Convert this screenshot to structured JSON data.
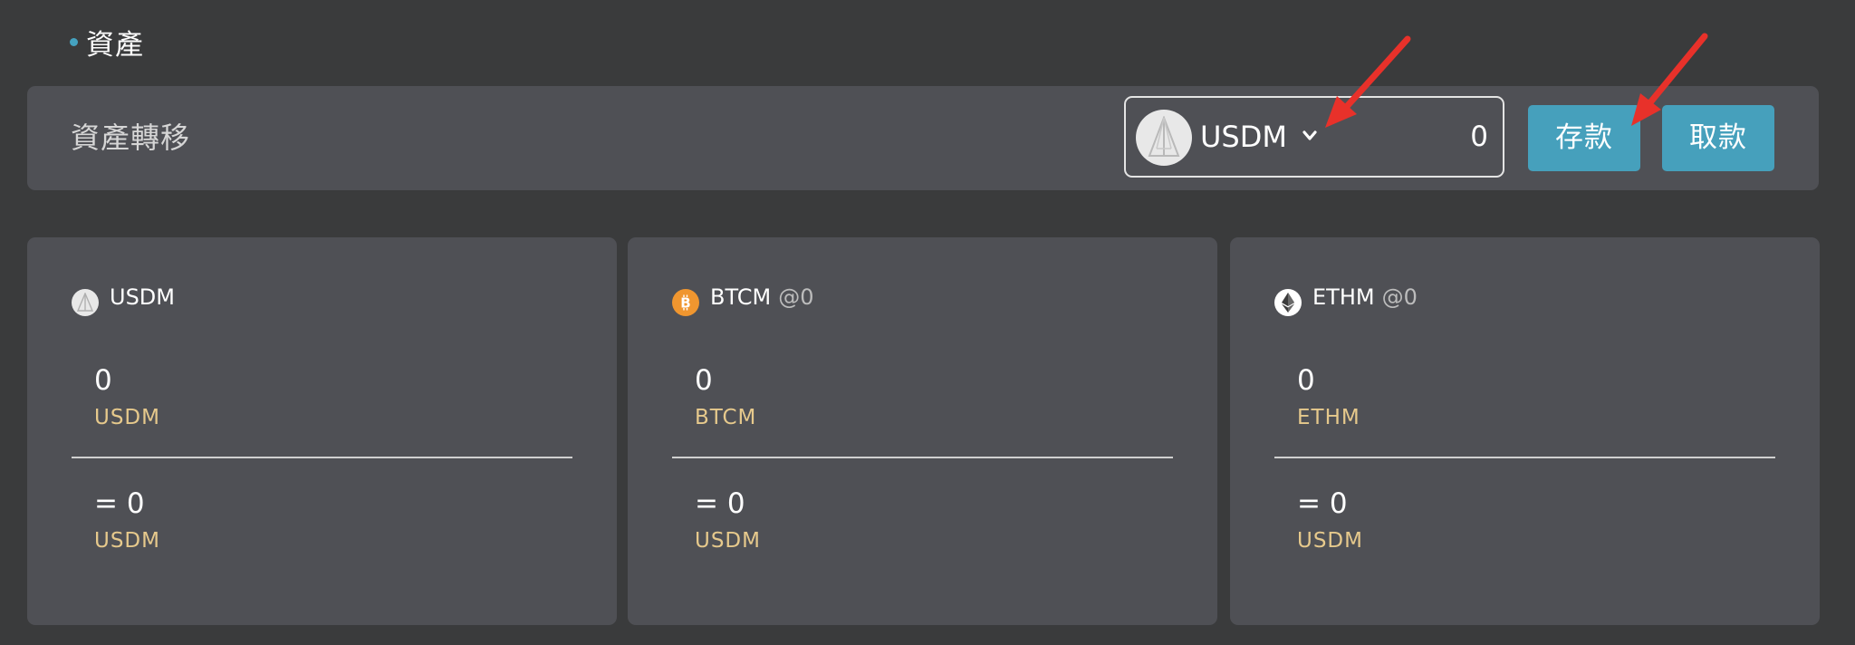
{
  "section": {
    "title": "資產"
  },
  "transfer": {
    "label": "資產轉移",
    "selected_asset": "USDM",
    "amount_value": "0",
    "deposit_label": "存款",
    "withdraw_label": "取款"
  },
  "cards": [
    {
      "icon": "usdm-coin-icon",
      "name": "USDM",
      "rate": "",
      "balance": "0",
      "balance_unit": "USDM",
      "equivalent": "= 0",
      "equivalent_unit": "USDM"
    },
    {
      "icon": "bitcoin-coin-icon",
      "name": "BTCM",
      "rate": "@0",
      "balance": "0",
      "balance_unit": "BTCM",
      "equivalent": "= 0",
      "equivalent_unit": "USDM"
    },
    {
      "icon": "ethereum-coin-icon",
      "name": "ETHM",
      "rate": "@0",
      "balance": "0",
      "balance_unit": "ETHM",
      "equivalent": "= 0",
      "equivalent_unit": "USDM"
    }
  ],
  "colors": {
    "page_bg": "#3a3b3c",
    "panel_bg": "#4f5055",
    "accent": "#46a0bc",
    "unit_text": "#e6c98c",
    "annotation_arrow": "#e8312a"
  }
}
